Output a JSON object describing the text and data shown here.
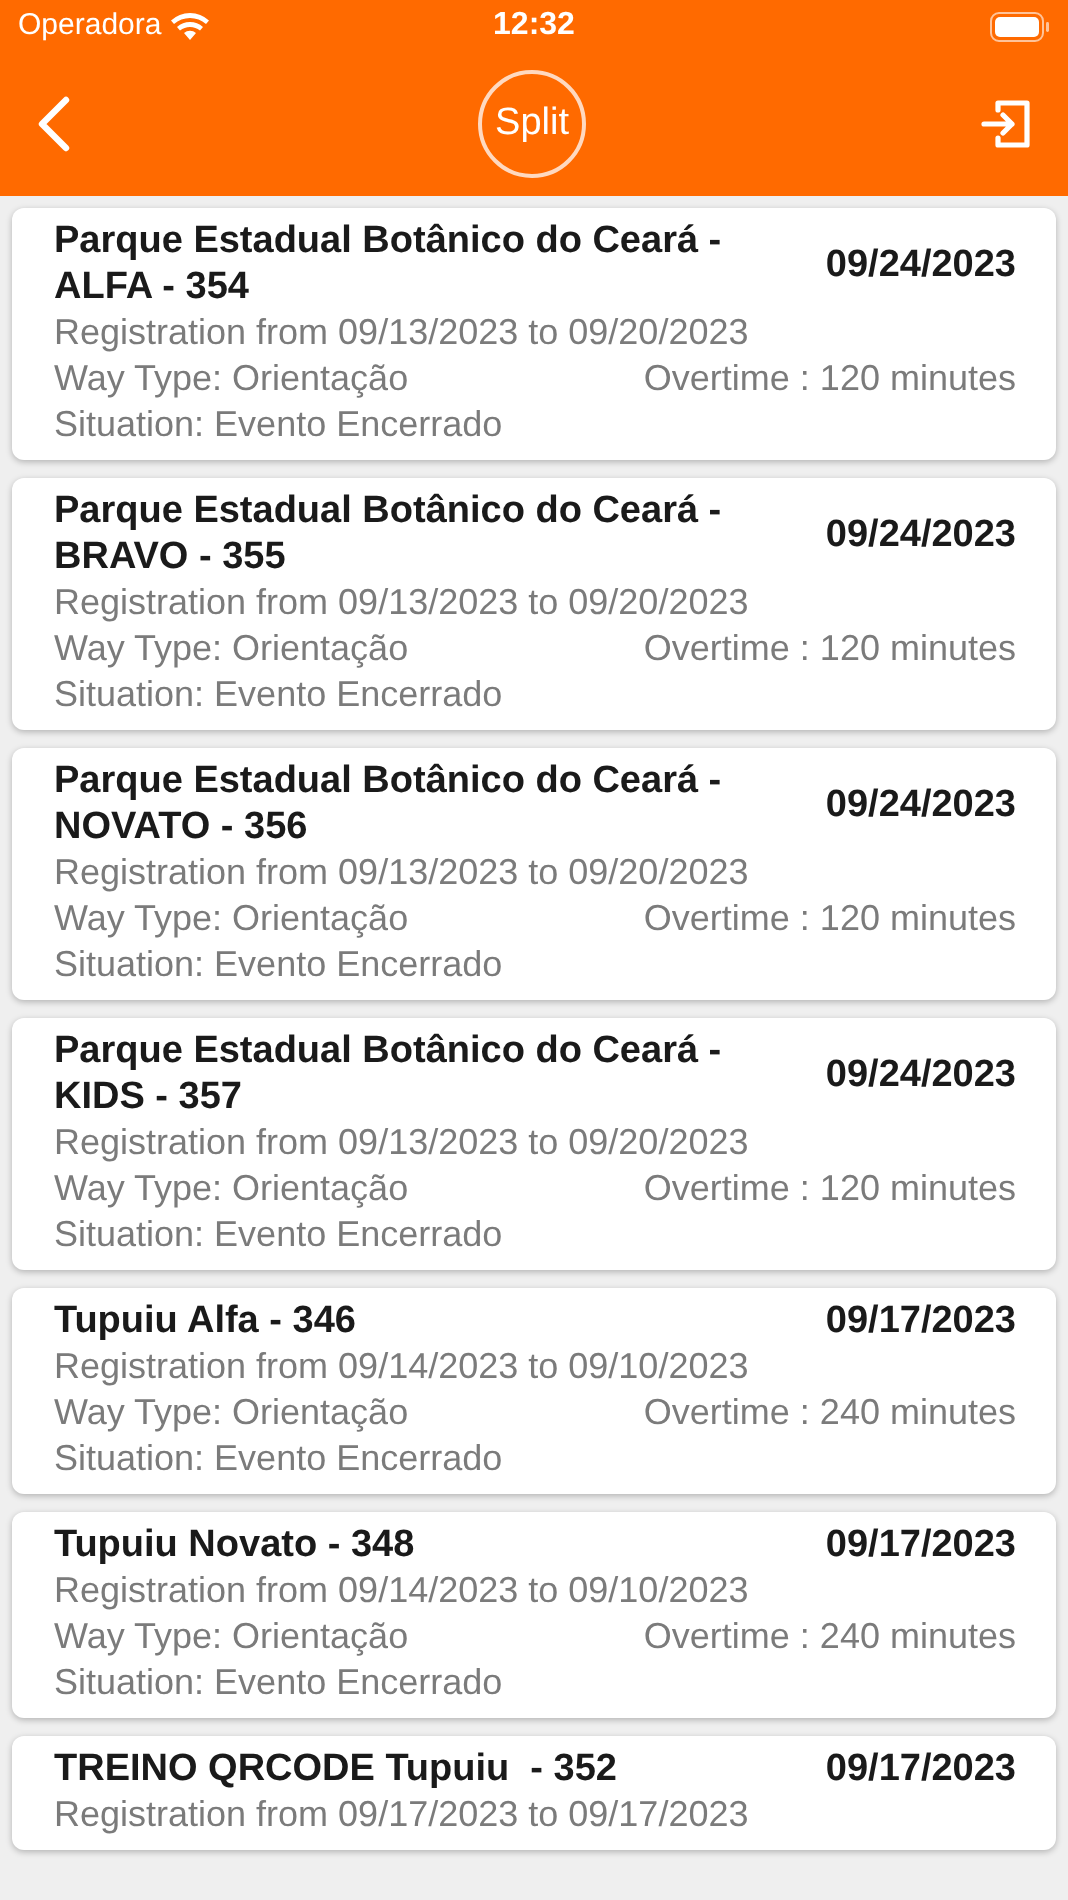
{
  "status_bar": {
    "carrier": "Operadora",
    "time": "12:32"
  },
  "header": {
    "logo": "Split"
  },
  "events": [
    {
      "title": "Parque Estadual Botânico do Ceará - ALFA - 354",
      "date": "09/24/2023",
      "registration": "Registration from 09/13/2023 to 09/20/2023",
      "way_type": "Way Type: Orientação",
      "overtime": "Overtime : 120 minutes",
      "situation": "Situation: Evento Encerrado"
    },
    {
      "title": "Parque Estadual Botânico do Ceará - BRAVO - 355",
      "date": "09/24/2023",
      "registration": "Registration from 09/13/2023 to 09/20/2023",
      "way_type": "Way Type: Orientação",
      "overtime": "Overtime : 120 minutes",
      "situation": "Situation: Evento Encerrado"
    },
    {
      "title": "Parque Estadual Botânico do Ceará - NOVATO - 356",
      "date": "09/24/2023",
      "registration": "Registration from 09/13/2023 to 09/20/2023",
      "way_type": "Way Type: Orientação",
      "overtime": "Overtime : 120 minutes",
      "situation": "Situation: Evento Encerrado"
    },
    {
      "title": "Parque Estadual Botânico do Ceará - KIDS - 357",
      "date": "09/24/2023",
      "registration": "Registration from 09/13/2023 to 09/20/2023",
      "way_type": "Way Type: Orientação",
      "overtime": "Overtime : 120 minutes",
      "situation": "Situation: Evento Encerrado"
    },
    {
      "title": "Tupuiu Alfa - 346",
      "date": "09/17/2023",
      "registration": "Registration from 09/14/2023 to 09/10/2023",
      "way_type": "Way Type: Orientação",
      "overtime": "Overtime : 240 minutes",
      "situation": "Situation: Evento Encerrado"
    },
    {
      "title": "Tupuiu Novato - 348",
      "date": "09/17/2023",
      "registration": "Registration from 09/14/2023 to 09/10/2023",
      "way_type": "Way Type: Orientação",
      "overtime": "Overtime : 240 minutes",
      "situation": "Situation: Evento Encerrado"
    },
    {
      "title": "TREINO QRCODE Tupuiu  - 352",
      "date": "09/17/2023",
      "registration": "Registration from 09/17/2023 to 09/17/2023"
    }
  ]
}
